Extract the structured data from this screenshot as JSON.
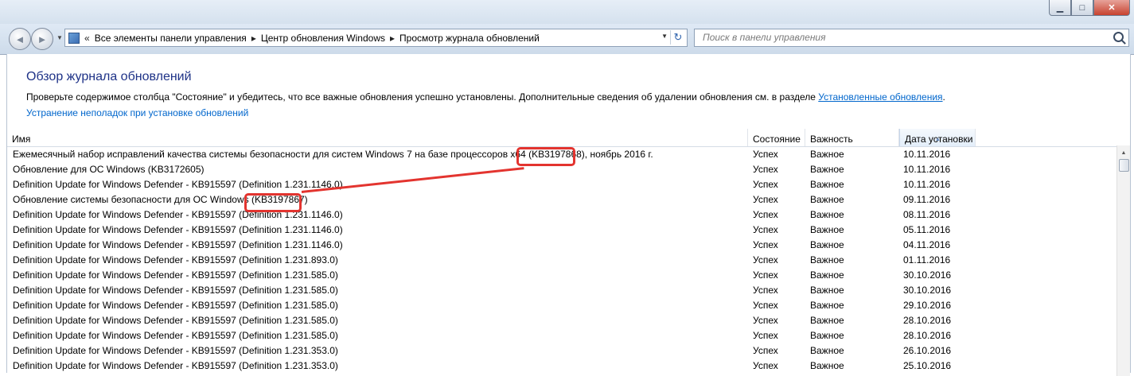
{
  "window": {
    "min_label": "▁",
    "max_label": "□",
    "close_label": "✕"
  },
  "nav": {
    "back_glyph": "◄",
    "forward_glyph": "►",
    "overflow_glyph": "«",
    "breadcrumbs": [
      "Все элементы панели управления",
      "Центр обновления Windows",
      "Просмотр журнала обновлений"
    ],
    "search_placeholder": "Поиск в панели управления"
  },
  "page": {
    "title": "Обзор журнала обновлений",
    "description": "Проверьте содержимое столбца \"Состояние\" и убедитесь, что все важные обновления успешно установлены. Дополнительные сведения об удалении обновления см. в разделе ",
    "installed_link": "Установленные обновления",
    "description_end": ".",
    "troubleshoot_link": "Устранение неполадок при установке обновлений"
  },
  "table": {
    "columns": [
      "Имя",
      "Состояние",
      "Важность",
      "Дата установки"
    ],
    "rows": [
      {
        "name": "Ежемесячный набор исправлений качества системы безопасности для систем Windows 7 на базе процессоров x64 (KB3197868), ноябрь 2016 г.",
        "state": "Успех",
        "importance": "Важное",
        "date": "10.11.2016"
      },
      {
        "name": "Обновление для ОС Windows (KB3172605)",
        "state": "Успех",
        "importance": "Важное",
        "date": "10.11.2016"
      },
      {
        "name": "Definition Update for Windows Defender - KB915597 (Definition 1.231.1146.0)",
        "state": "Успех",
        "importance": "Важное",
        "date": "10.11.2016"
      },
      {
        "name": "Обновление системы безопасности для ОС Windows (KB3197867)",
        "state": "Успех",
        "importance": "Важное",
        "date": "09.11.2016"
      },
      {
        "name": "Definition Update for Windows Defender - KB915597 (Definition 1.231.1146.0)",
        "state": "Успех",
        "importance": "Важное",
        "date": "08.11.2016"
      },
      {
        "name": "Definition Update for Windows Defender - KB915597 (Definition 1.231.1146.0)",
        "state": "Успех",
        "importance": "Важное",
        "date": "05.11.2016"
      },
      {
        "name": "Definition Update for Windows Defender - KB915597 (Definition 1.231.1146.0)",
        "state": "Успех",
        "importance": "Важное",
        "date": "04.11.2016"
      },
      {
        "name": "Definition Update for Windows Defender - KB915597 (Definition 1.231.893.0)",
        "state": "Успех",
        "importance": "Важное",
        "date": "01.11.2016"
      },
      {
        "name": "Definition Update for Windows Defender - KB915597 (Definition 1.231.585.0)",
        "state": "Успех",
        "importance": "Важное",
        "date": "30.10.2016"
      },
      {
        "name": "Definition Update for Windows Defender - KB915597 (Definition 1.231.585.0)",
        "state": "Успех",
        "importance": "Важное",
        "date": "30.10.2016"
      },
      {
        "name": "Definition Update for Windows Defender - KB915597 (Definition 1.231.585.0)",
        "state": "Успех",
        "importance": "Важное",
        "date": "29.10.2016"
      },
      {
        "name": "Definition Update for Windows Defender - KB915597 (Definition 1.231.585.0)",
        "state": "Успех",
        "importance": "Важное",
        "date": "28.10.2016"
      },
      {
        "name": "Definition Update for Windows Defender - KB915597 (Definition 1.231.585.0)",
        "state": "Успех",
        "importance": "Важное",
        "date": "28.10.2016"
      },
      {
        "name": "Definition Update for Windows Defender - KB915597 (Definition 1.231.353.0)",
        "state": "Успех",
        "importance": "Важное",
        "date": "26.10.2016"
      },
      {
        "name": "Definition Update for Windows Defender - KB915597 (Definition 1.231.353.0)",
        "state": "Успех",
        "importance": "Важное",
        "date": "25.10.2016"
      }
    ]
  },
  "colors": {
    "title_blue": "#1e3287",
    "link_blue": "#0066cc",
    "highlight_red": "#e3342f"
  }
}
